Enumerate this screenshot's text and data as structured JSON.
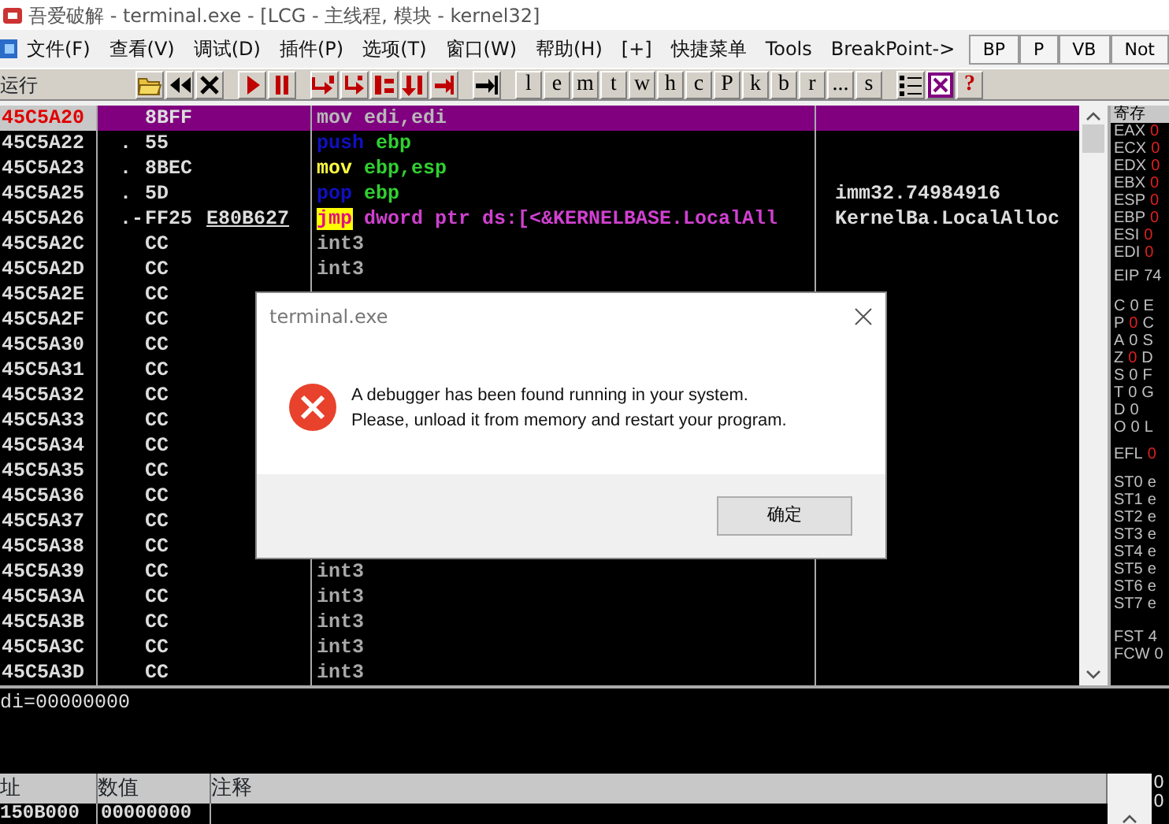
{
  "title_bar": {
    "title": "吾爱破解 - terminal.exe - [LCG -  主线程, 模块 - kernel32]"
  },
  "menu": [
    "文件(F)",
    "查看(V)",
    "调试(D)",
    "插件(P)",
    "选项(T)",
    "窗口(W)",
    "帮助(H)",
    "[+]",
    "快捷菜单",
    "Tools",
    "BreakPoint->"
  ],
  "top_tabs": [
    "BP",
    "P",
    "VB",
    "Not"
  ],
  "toolbar": {
    "status": "运行",
    "letters": [
      "l",
      "e",
      "m",
      "t",
      "w",
      "h",
      "c",
      "P",
      "k",
      "b",
      "r",
      "...",
      "s"
    ],
    "help": "?"
  },
  "disassembly": {
    "rows": [
      {
        "address": "45C5A20",
        "mark": "",
        "hex": "8BFF",
        "selected": true,
        "instruction": [
          {
            "text": "mov edi,edi",
            "kind": "sel"
          }
        ]
      },
      {
        "address": "45C5A22",
        "mark": ".",
        "hex": "55",
        "selected": false,
        "instruction": [
          {
            "text": "push",
            "kind": "stack"
          },
          {
            "text": " ebp",
            "kind": "reg"
          }
        ]
      },
      {
        "address": "45C5A23",
        "mark": ".",
        "hex": "8BEC",
        "selected": false,
        "instruction": [
          {
            "text": "mov",
            "kind": "move"
          },
          {
            "text": " ebp,esp",
            "kind": "reg"
          }
        ]
      },
      {
        "address": "45C5A25",
        "mark": ".",
        "hex": "5D",
        "selected": false,
        "instruction": [
          {
            "text": "pop",
            "kind": "stack"
          },
          {
            "text": " ebp",
            "kind": "reg"
          }
        ],
        "comment": "imm32.74984916"
      },
      {
        "address": "45C5A26",
        "mark": ".-",
        "hex": "FF25",
        "hex_link": "E80B627",
        "selected": false,
        "instruction": [
          {
            "text": "jmp",
            "kind": "jump"
          },
          {
            "text": " dword ptr ds:[<&KERNELBASE.LocalAll",
            "kind": "mem"
          }
        ],
        "comment": "KernelBa.LocalAlloc"
      },
      {
        "address": "45C5A2C",
        "mark": "",
        "hex": "CC",
        "selected": false,
        "instruction": [
          {
            "text": "int3",
            "kind": "filler"
          }
        ]
      },
      {
        "address": "45C5A2D",
        "mark": "",
        "hex": "CC",
        "selected": false,
        "instruction": [
          {
            "text": "int3",
            "kind": "filler"
          }
        ]
      },
      {
        "address": "45C5A2E",
        "mark": "",
        "hex": "CC",
        "selected": false
      },
      {
        "address": "45C5A2F",
        "mark": "",
        "hex": "CC",
        "selected": false
      },
      {
        "address": "45C5A30",
        "mark": "",
        "hex": "CC",
        "selected": false
      },
      {
        "address": "45C5A31",
        "mark": "",
        "hex": "CC",
        "selected": false
      },
      {
        "address": "45C5A32",
        "mark": "",
        "hex": "CC",
        "selected": false
      },
      {
        "address": "45C5A33",
        "mark": "",
        "hex": "CC",
        "selected": false
      },
      {
        "address": "45C5A34",
        "mark": "",
        "hex": "CC",
        "selected": false
      },
      {
        "address": "45C5A35",
        "mark": "",
        "hex": "CC",
        "selected": false
      },
      {
        "address": "45C5A36",
        "mark": "",
        "hex": "CC",
        "selected": false
      },
      {
        "address": "45C5A37",
        "mark": "",
        "hex": "CC",
        "selected": false
      },
      {
        "address": "45C5A38",
        "mark": "",
        "hex": "CC",
        "selected": false
      },
      {
        "address": "45C5A39",
        "mark": "",
        "hex": "CC",
        "selected": false,
        "instruction": [
          {
            "text": "int3",
            "kind": "filler"
          }
        ]
      },
      {
        "address": "45C5A3A",
        "mark": "",
        "hex": "CC",
        "selected": false,
        "instruction": [
          {
            "text": "int3",
            "kind": "filler"
          }
        ]
      },
      {
        "address": "45C5A3B",
        "mark": "",
        "hex": "CC",
        "selected": false,
        "instruction": [
          {
            "text": "int3",
            "kind": "filler"
          }
        ]
      },
      {
        "address": "45C5A3C",
        "mark": "",
        "hex": "CC",
        "selected": false,
        "instruction": [
          {
            "text": "int3",
            "kind": "filler"
          }
        ]
      },
      {
        "address": "45C5A3D",
        "mark": "",
        "hex": "CC",
        "selected": false,
        "instruction": [
          {
            "text": "int3",
            "kind": "filler"
          }
        ]
      }
    ]
  },
  "info": {
    "text": "di=00000000"
  },
  "registers": {
    "header": "寄存",
    "items": [
      {
        "name": "EAX",
        "value": "0",
        "changed": true
      },
      {
        "name": "ECX",
        "value": "0",
        "changed": true
      },
      {
        "name": "EDX",
        "value": "0",
        "changed": true
      },
      {
        "name": "EBX",
        "value": "0",
        "changed": true
      },
      {
        "name": "ESP",
        "value": "0",
        "changed": true
      },
      {
        "name": "EBP",
        "value": "0",
        "changed": true
      },
      {
        "name": "ESI",
        "value": "0",
        "changed": true
      },
      {
        "name": "EDI",
        "value": "0",
        "changed": true
      }
    ],
    "eip": {
      "name": "EIP",
      "value": "74"
    },
    "flags": [
      {
        "name": "C",
        "value": "0",
        "changed": false,
        "segment": "E"
      },
      {
        "name": "P",
        "value": "0",
        "changed": true,
        "segment": "C"
      },
      {
        "name": "A",
        "value": "0",
        "changed": false,
        "segment": "S"
      },
      {
        "name": "Z",
        "value": "0",
        "changed": true,
        "segment": "D"
      },
      {
        "name": "S",
        "value": "0",
        "changed": false,
        "segment": "F"
      },
      {
        "name": "T",
        "value": "0",
        "changed": false,
        "segment": "G"
      },
      {
        "name": "D",
        "value": "0",
        "changed": false
      },
      {
        "name": "O",
        "value": "0",
        "changed": false,
        "segment": "L"
      }
    ],
    "efl": {
      "name": "EFL",
      "value": "0",
      "changed": true
    },
    "fpu": [
      {
        "name": "ST0",
        "value": "e"
      },
      {
        "name": "ST1",
        "value": "e"
      },
      {
        "name": "ST2",
        "value": "e"
      },
      {
        "name": "ST3",
        "value": "e"
      },
      {
        "name": "ST4",
        "value": "e"
      },
      {
        "name": "ST5",
        "value": "e"
      },
      {
        "name": "ST6",
        "value": "e"
      },
      {
        "name": "ST7",
        "value": "e"
      }
    ],
    "fpu_status": [
      {
        "name": "FST",
        "value": "4"
      },
      {
        "name": "FCW",
        "value": "0"
      }
    ]
  },
  "dump": {
    "columns": [
      "址",
      "数值",
      "注释"
    ],
    "rows": [
      {
        "address": "150B000",
        "value": "00000000"
      }
    ]
  },
  "stack": {
    "values": [
      "0",
      "0"
    ]
  },
  "dialog": {
    "title": "terminal.exe",
    "message": [
      "A debugger has been found running in your system.",
      "Please, unload it from memory and restart your program."
    ],
    "button": "确定"
  }
}
